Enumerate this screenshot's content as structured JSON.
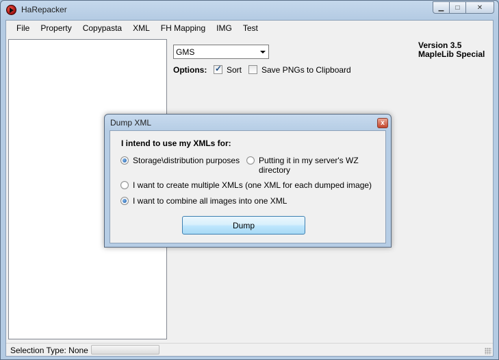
{
  "window": {
    "title": "HaRepacker"
  },
  "menu": [
    "File",
    "Property",
    "Copypasta",
    "XML",
    "FH Mapping",
    "IMG",
    "Test"
  ],
  "region": {
    "selected": "GMS"
  },
  "options": {
    "label": "Options:",
    "sort": {
      "label": "Sort",
      "checked": true
    },
    "save_pngs": {
      "label": "Save PNGs to Clipboard",
      "checked": false
    }
  },
  "version": {
    "line1": "Version 3.5",
    "line2": "MapleLib Special"
  },
  "status": {
    "text": "Selection Type: None",
    "progress": 0
  },
  "dialog": {
    "title": "Dump XML",
    "close_glyph": "x",
    "heading": "I intend to use my XMLs for:",
    "purpose_options": [
      {
        "label": "Storage\\distribution purposes",
        "selected": true
      },
      {
        "label": "Putting it in my server's WZ directory",
        "selected": false
      }
    ],
    "mode_options": [
      {
        "label": "I want to create multiple XMLs (one XML for each dumped image)",
        "selected": false
      },
      {
        "label": "I want to combine all images into one XML",
        "selected": true
      }
    ],
    "dump_label": "Dump"
  }
}
